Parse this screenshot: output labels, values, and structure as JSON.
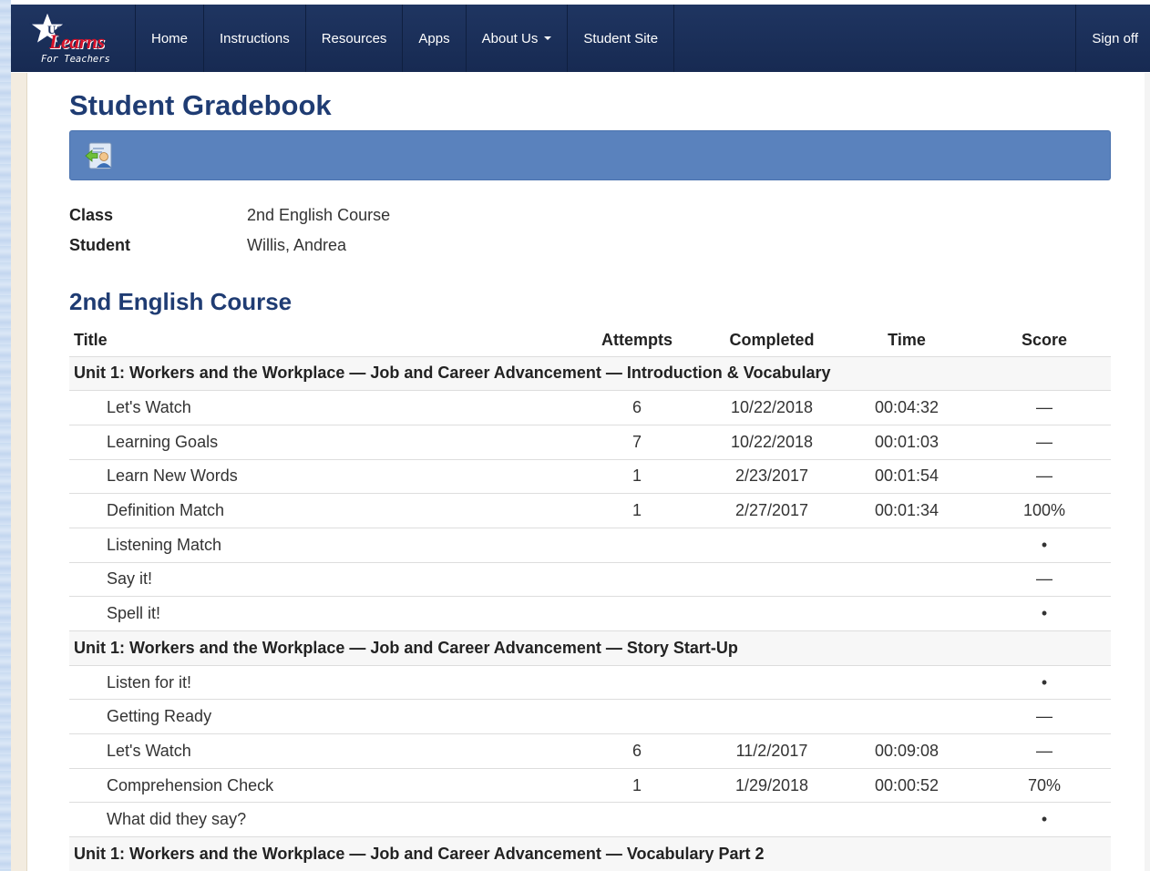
{
  "nav": {
    "brand_top": "USA",
    "brand_main": "Learns",
    "brand_sub": "For Teachers",
    "items": [
      {
        "label": "Home"
      },
      {
        "label": "Instructions"
      },
      {
        "label": "Resources"
      },
      {
        "label": "Apps"
      },
      {
        "label": "About Us",
        "dropdown": true
      },
      {
        "label": "Student Site"
      }
    ],
    "signoff": "Sign off"
  },
  "page": {
    "title": "Student Gradebook",
    "toolbar_icon": "back-to-student-list-icon"
  },
  "info": {
    "class_label": "Class",
    "class_value": "2nd English Course",
    "student_label": "Student",
    "student_value": "Willis, Andrea"
  },
  "course": {
    "title": "2nd English Course",
    "columns": {
      "title": "Title",
      "attempts": "Attempts",
      "completed": "Completed",
      "time": "Time",
      "score": "Score"
    },
    "rows": [
      {
        "type": "unit",
        "title": "Unit 1:  Workers and the Workplace — Job and Career Advancement — Introduction & Vocabulary"
      },
      {
        "type": "item",
        "title": "Let's Watch",
        "attempts": "6",
        "completed": "10/22/2018",
        "time": "00:04:32",
        "score": "—"
      },
      {
        "type": "item",
        "title": "Learning Goals",
        "attempts": "7",
        "completed": "10/22/2018",
        "time": "00:01:03",
        "score": "—"
      },
      {
        "type": "item",
        "title": "Learn New Words",
        "attempts": "1",
        "completed": "2/23/2017",
        "time": "00:01:54",
        "score": "—"
      },
      {
        "type": "item",
        "title": "Definition Match",
        "attempts": "1",
        "completed": "2/27/2017",
        "time": "00:01:34",
        "score": "100%"
      },
      {
        "type": "item",
        "title": "Listening Match",
        "attempts": "",
        "completed": "",
        "time": "",
        "score": "•"
      },
      {
        "type": "item",
        "title": "Say it!",
        "attempts": "",
        "completed": "",
        "time": "",
        "score": "—"
      },
      {
        "type": "item",
        "title": "Spell it!",
        "attempts": "",
        "completed": "",
        "time": "",
        "score": "•"
      },
      {
        "type": "unit",
        "title": "Unit 1:  Workers and the Workplace — Job and Career Advancement — Story Start-Up"
      },
      {
        "type": "item",
        "title": "Listen for it!",
        "attempts": "",
        "completed": "",
        "time": "",
        "score": "•"
      },
      {
        "type": "item",
        "title": "Getting Ready",
        "attempts": "",
        "completed": "",
        "time": "",
        "score": "—"
      },
      {
        "type": "item",
        "title": "Let's Watch",
        "attempts": "6",
        "completed": "11/2/2017",
        "time": "00:09:08",
        "score": "—"
      },
      {
        "type": "item",
        "title": "Comprehension Check",
        "attempts": "1",
        "completed": "1/29/2018",
        "time": "00:00:52",
        "score": "70%"
      },
      {
        "type": "item",
        "title": "What did they say?",
        "attempts": "",
        "completed": "",
        "time": "",
        "score": "•"
      },
      {
        "type": "unit",
        "title": "Unit 1:  Workers and the Workplace — Job and Career Advancement — Vocabulary Part 2"
      }
    ]
  },
  "colors": {
    "navbar": "#1f3561",
    "title": "#1f3c73",
    "toolbar": "#5a82bd"
  }
}
